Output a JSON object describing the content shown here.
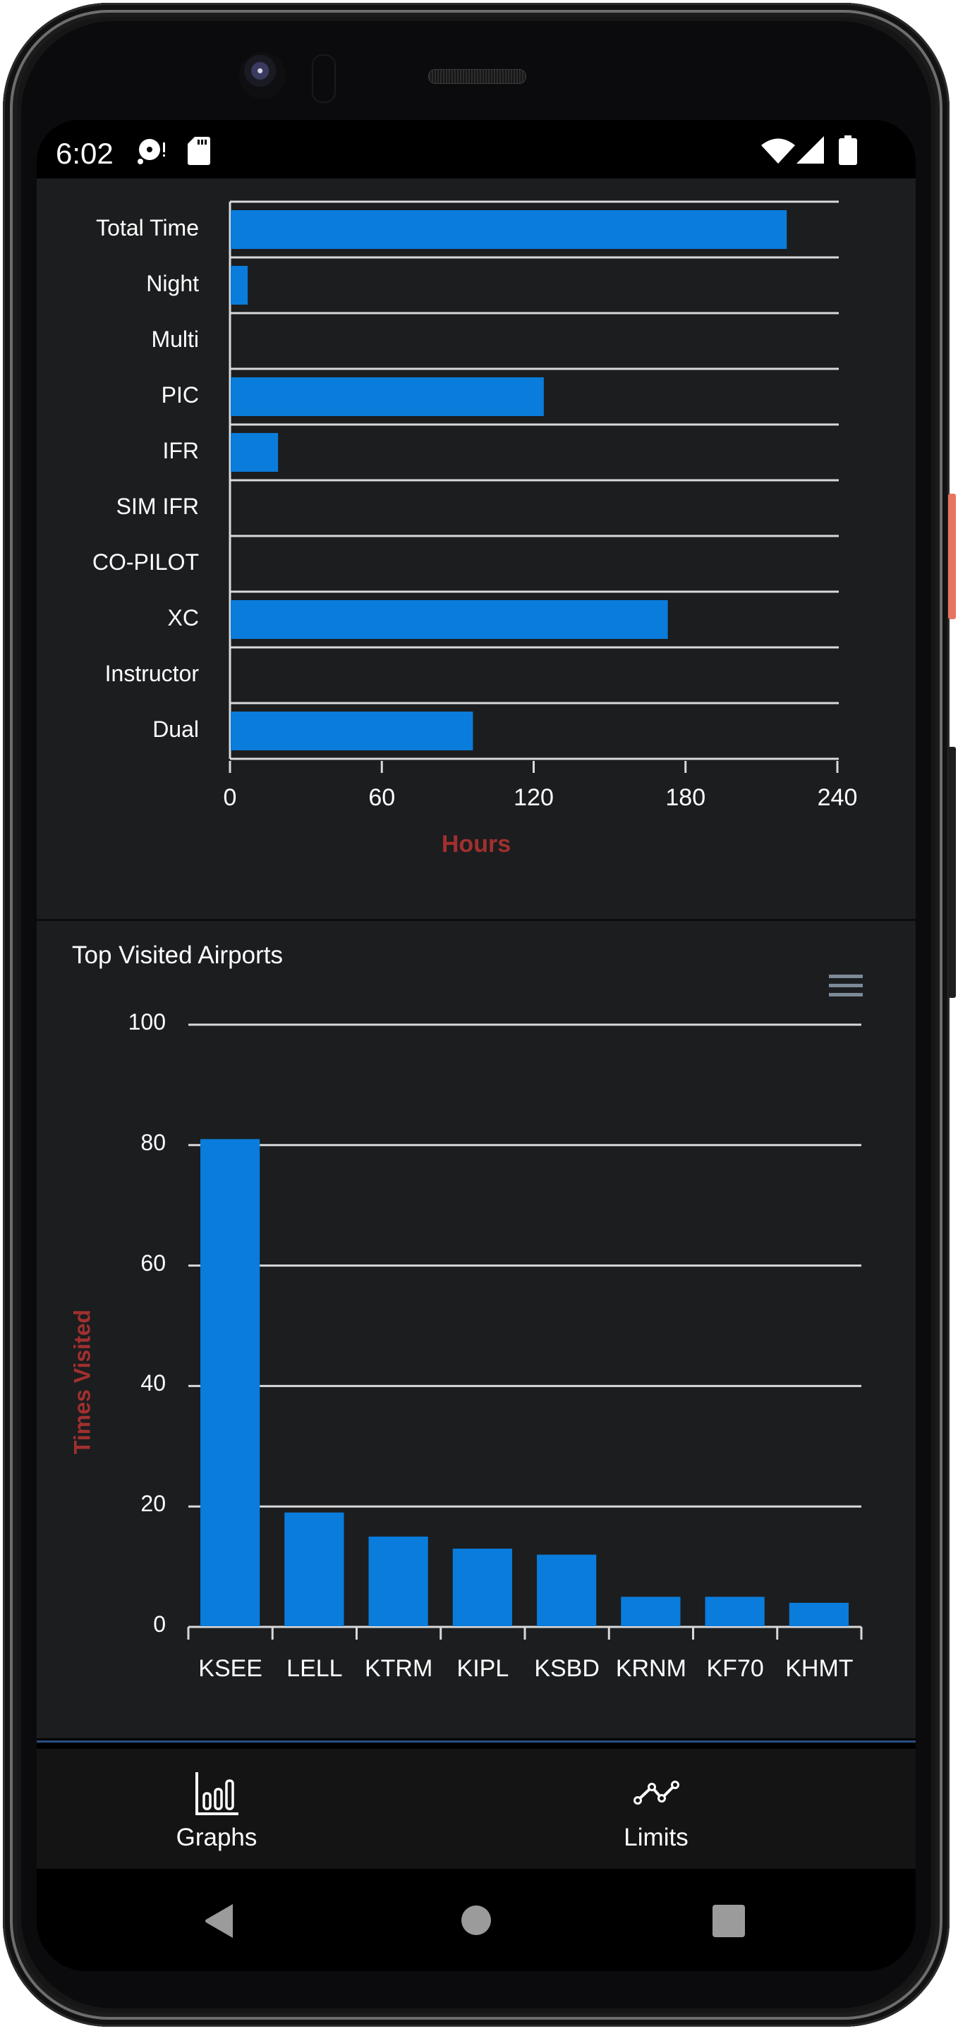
{
  "status_bar": {
    "time": "6:02",
    "left_icons": [
      "disc-alert-icon",
      "sd-card-icon"
    ],
    "right_icons": [
      "wifi-icon",
      "cell-signal-icon",
      "battery-icon"
    ]
  },
  "colors": {
    "bar": "#0a7cdb",
    "axis_title": "#a1302f",
    "background": "#1c1d1f",
    "gridline": "#d9d9d9"
  },
  "chart_data": [
    {
      "type": "bar",
      "orientation": "horizontal",
      "title": "",
      "categories": [
        "Total Time",
        "Night",
        "Multi",
        "PIC",
        "IFR",
        "SIM IFR",
        "CO-PILOT",
        "XC",
        "Instructor",
        "Dual"
      ],
      "values": [
        220,
        7,
        0,
        124,
        19,
        0,
        0,
        173,
        0,
        96
      ],
      "xlabel": "Hours",
      "ylabel": "",
      "xlim": [
        0,
        240
      ],
      "xticks": [
        "0",
        "60",
        "120",
        "180",
        "240"
      ],
      "xtick_values": [
        0,
        60,
        120,
        180,
        240
      ],
      "grid": true
    },
    {
      "type": "bar",
      "orientation": "vertical",
      "title": "Top Visited Airports",
      "categories": [
        "KSEE",
        "LELL",
        "KTRM",
        "KIPL",
        "KSBD",
        "KRNM",
        "KF70",
        "KHMT"
      ],
      "values": [
        81,
        19,
        15,
        13,
        12,
        5,
        5,
        4
      ],
      "xlabel": "",
      "ylabel": "Times Visited",
      "ylim": [
        0,
        100
      ],
      "yticks": [
        "0",
        "20",
        "40",
        "60",
        "80",
        "100"
      ],
      "ytick_values": [
        0,
        20,
        40,
        60,
        80,
        100
      ],
      "grid": true
    }
  ],
  "chart2_menu_icon": "hamburger-menu-icon",
  "bottom_nav": {
    "items": [
      {
        "label": "Graphs",
        "icon": "bar-chart-icon"
      },
      {
        "label": "Limits",
        "icon": "line-chart-icon"
      }
    ]
  },
  "system_nav": [
    "back-icon",
    "home-icon",
    "recents-icon"
  ]
}
